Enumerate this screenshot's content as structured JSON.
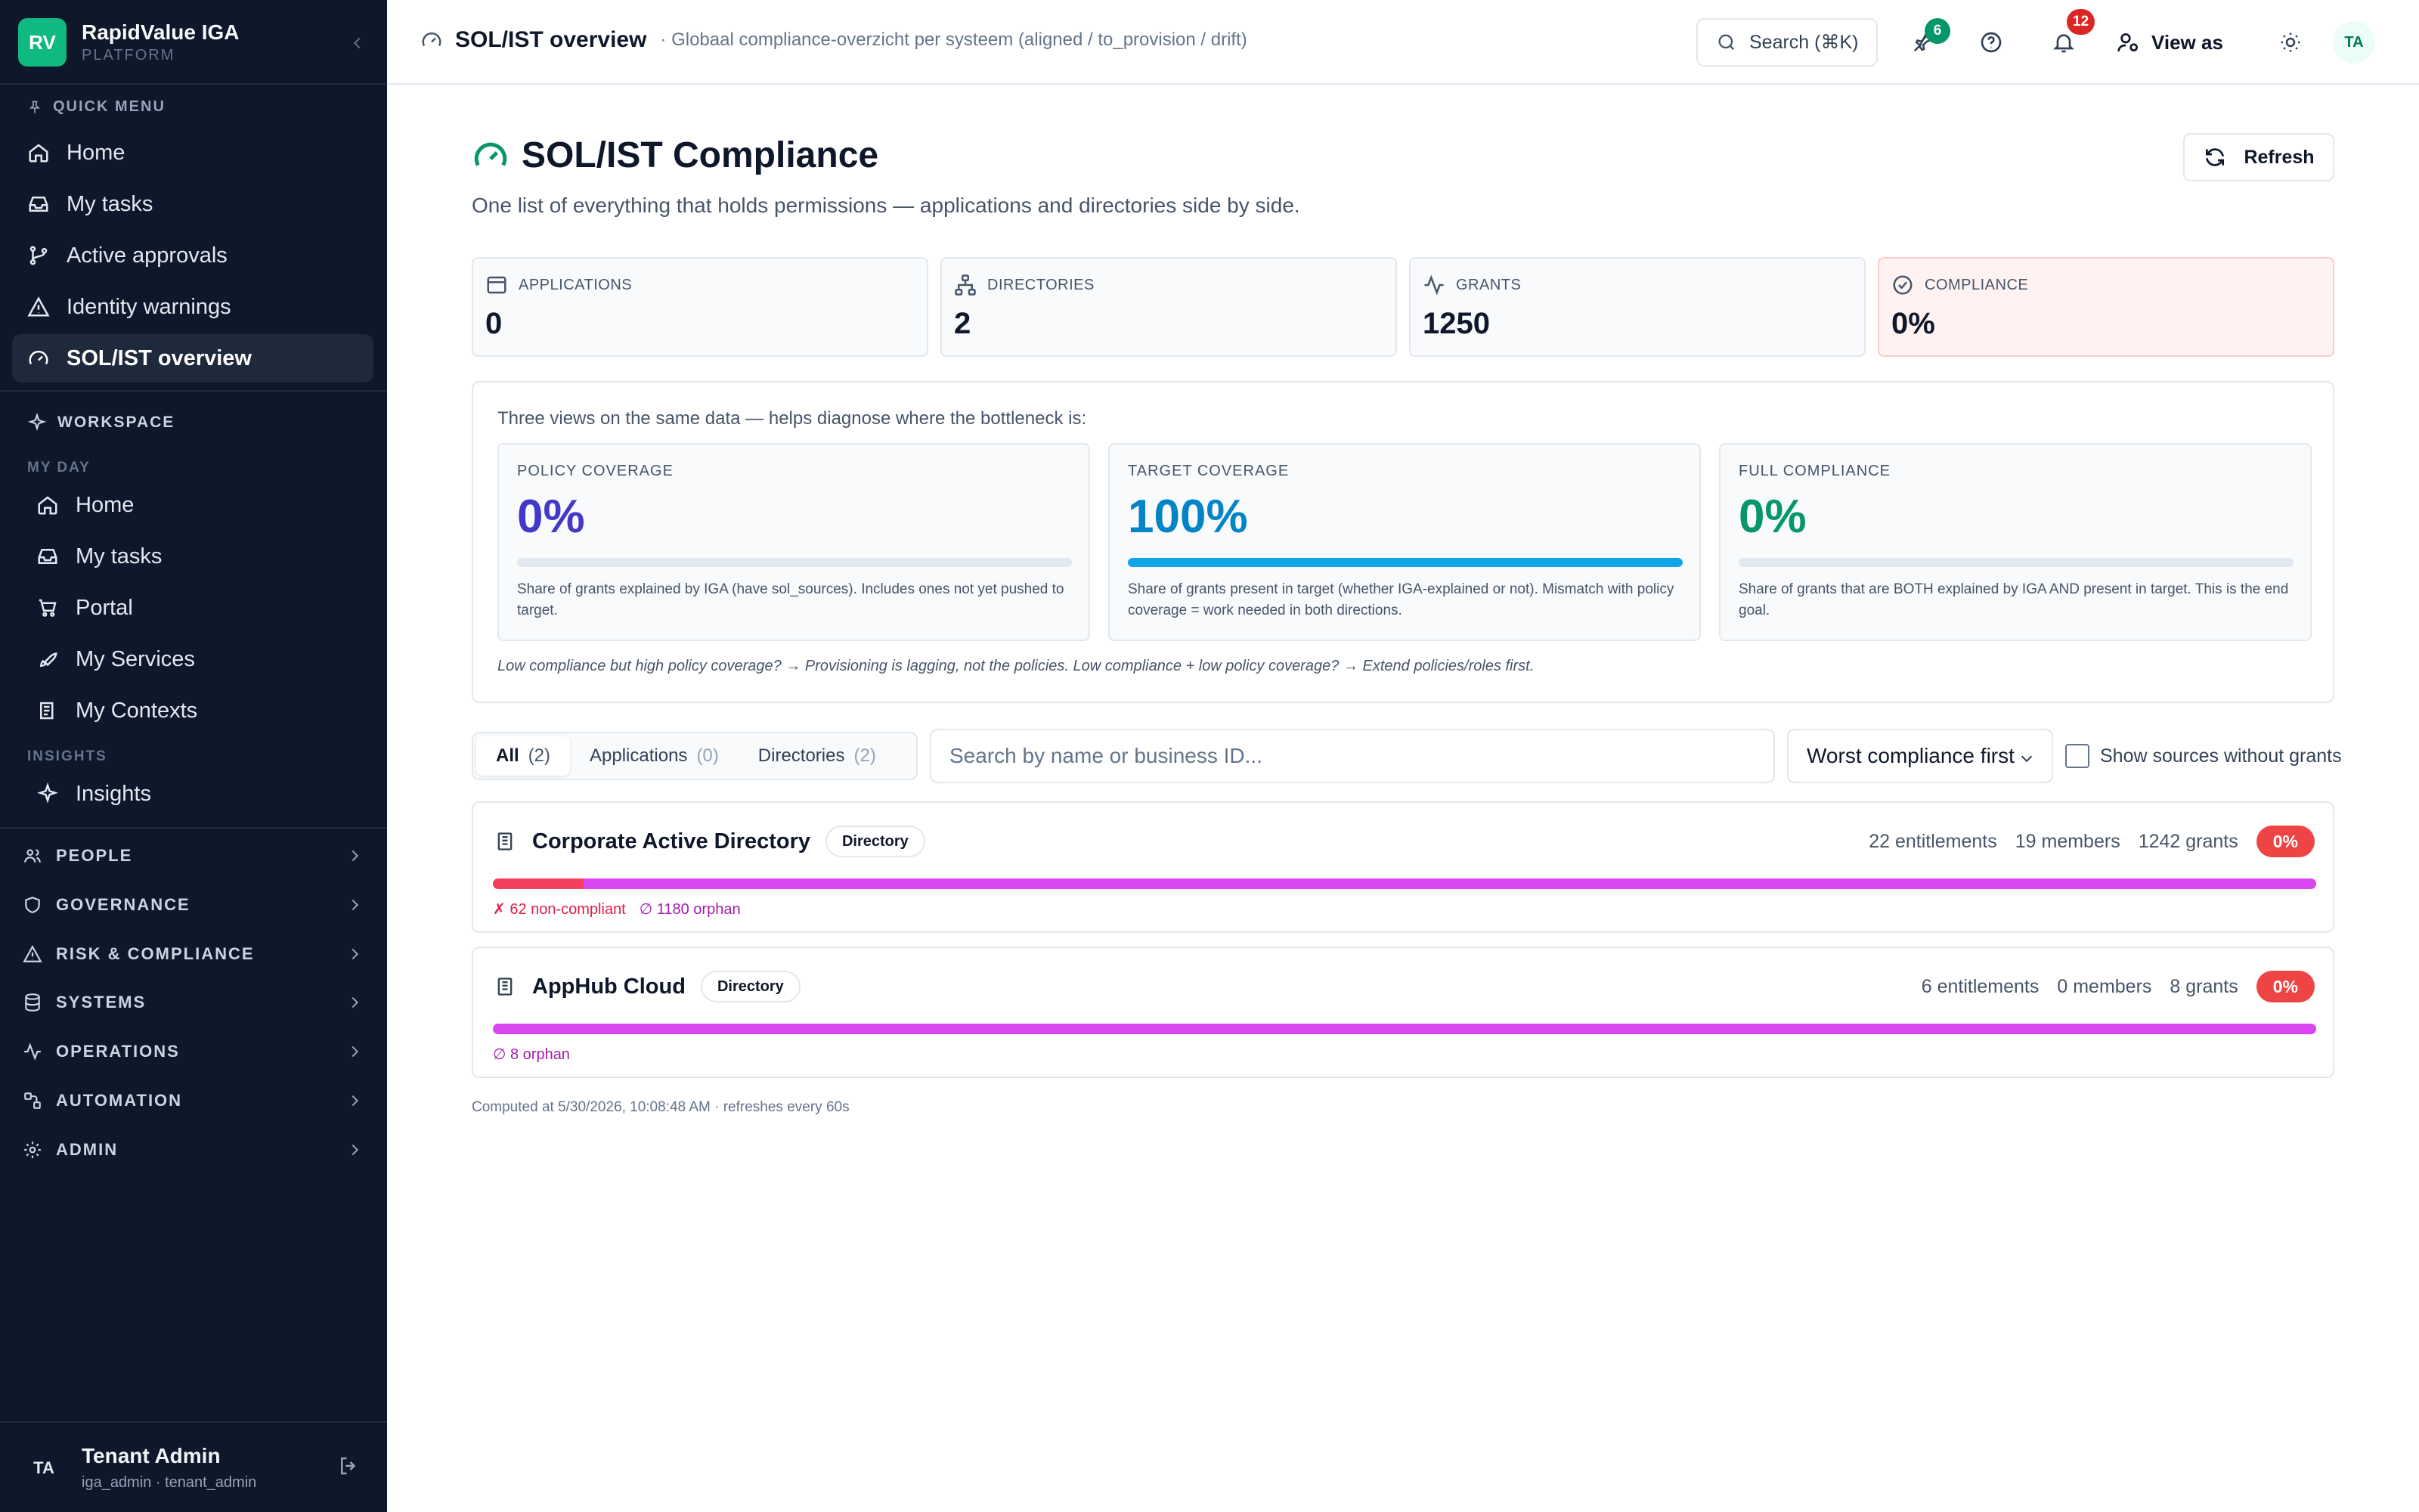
{
  "brand": {
    "logo": "RV",
    "name": "RapidValue IGA",
    "sub": "PLATFORM"
  },
  "sidebar": {
    "quick_menu_label": "QUICK MENU",
    "quick_items": [
      {
        "label": "Home",
        "icon": "home-icon"
      },
      {
        "label": "My tasks",
        "icon": "inbox-icon"
      },
      {
        "label": "Active approvals",
        "icon": "git-branch-icon"
      },
      {
        "label": "Identity warnings",
        "icon": "warning-icon"
      },
      {
        "label": "SOL/IST overview",
        "icon": "gauge-icon",
        "active": true
      }
    ],
    "workspace_label": "WORKSPACE",
    "my_day_label": "MY DAY",
    "my_day_items": [
      {
        "label": "Home",
        "icon": "home-icon"
      },
      {
        "label": "My tasks",
        "icon": "inbox-icon"
      },
      {
        "label": "Portal",
        "icon": "cart-icon"
      },
      {
        "label": "My Services",
        "icon": "rocket-icon"
      },
      {
        "label": "My Contexts",
        "icon": "book-icon"
      }
    ],
    "insights_label": "INSIGHTS",
    "insights_items": [
      {
        "label": "Insights",
        "icon": "sparkle-icon"
      }
    ],
    "groups": [
      {
        "label": "PEOPLE",
        "icon": "users-icon"
      },
      {
        "label": "GOVERNANCE",
        "icon": "shield-icon"
      },
      {
        "label": "RISK & COMPLIANCE",
        "icon": "warning-icon"
      },
      {
        "label": "SYSTEMS",
        "icon": "database-icon"
      },
      {
        "label": "OPERATIONS",
        "icon": "activity-icon"
      },
      {
        "label": "AUTOMATION",
        "icon": "workflow-icon"
      },
      {
        "label": "ADMIN",
        "icon": "gear-icon"
      }
    ]
  },
  "user": {
    "initials": "TA",
    "name": "Tenant Admin",
    "role": "iga_admin · tenant_admin"
  },
  "topbar": {
    "title": "SOL/IST overview",
    "description": "· Globaal compliance-overzicht per systeem (aligned / to_provision / drift)",
    "search_label": "Search (⌘K)",
    "pins_badge": "6",
    "notifications_badge": "12",
    "view_as": "View as",
    "avatar": "TA"
  },
  "page": {
    "title": "SOL/IST Compliance",
    "subtitle": "One list of everything that holds permissions — applications and directories side by side.",
    "refresh_label": "Refresh"
  },
  "stats": [
    {
      "label": "APPLICATIONS",
      "value": "0",
      "icon": "window-icon"
    },
    {
      "label": "DIRECTORIES",
      "value": "2",
      "icon": "hierarchy-icon"
    },
    {
      "label": "GRANTS",
      "value": "1250",
      "icon": "activity-icon"
    },
    {
      "label": "COMPLIANCE",
      "value": "0%",
      "icon": "check-circle-icon"
    }
  ],
  "views": {
    "intro": "Three views on the same data — helps diagnose where the bottleneck is:",
    "cards": [
      {
        "label": "POLICY COVERAGE",
        "value": "0%",
        "fill": 0,
        "color": "#4338ca",
        "bar_color": "#4f46e5",
        "desc": "Share of grants explained by IGA (have sol_sources). Includes ones not yet pushed to target."
      },
      {
        "label": "TARGET COVERAGE",
        "value": "100%",
        "fill": 100,
        "color": "#0284c7",
        "bar_color": "#0ea5e9",
        "desc": "Share of grants present in target (whether IGA-explained or not). Mismatch with policy coverage = work needed in both directions."
      },
      {
        "label": "FULL COMPLIANCE",
        "value": "0%",
        "fill": 0,
        "color": "#059669",
        "bar_color": "#10b981",
        "desc": "Share of grants that are BOTH explained by IGA AND present in target. This is the end goal."
      }
    ],
    "note": "Low compliance but high policy coverage? → Provisioning is lagging, not the policies. Low compliance + low policy coverage? → Extend policies/roles first."
  },
  "filters": {
    "tabs": [
      {
        "label": "All",
        "count": "(2)",
        "active": true
      },
      {
        "label": "Applications",
        "count": "(0)"
      },
      {
        "label": "Directories",
        "count": "(2)"
      }
    ],
    "search_placeholder": "Search by name or business ID...",
    "sort_selected": "Worst compliance first",
    "show_sources_label": "Show sources without grants"
  },
  "sources": [
    {
      "name": "Corporate Active Directory",
      "type": "Directory",
      "entitlements": "22 entitlements",
      "members": "19 members",
      "grants": "1242 grants",
      "compliance": "0%",
      "non_compliant": 62,
      "orphan": 1180,
      "total": 1242,
      "non_compliant_label": "✗ 62 non-compliant",
      "orphan_label": "∅ 1180 orphan"
    },
    {
      "name": "AppHub Cloud",
      "type": "Directory",
      "entitlements": "6 entitlements",
      "members": "0 members",
      "grants": "8 grants",
      "compliance": "0%",
      "non_compliant": 0,
      "orphan": 8,
      "total": 8,
      "non_compliant_label": "",
      "orphan_label": "∅ 8 orphan"
    }
  ],
  "computed": "Computed at 5/30/2026, 10:08:48 AM · refreshes every 60s"
}
